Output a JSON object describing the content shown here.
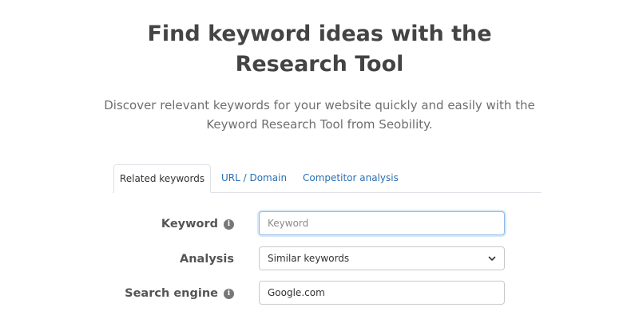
{
  "hero": {
    "title_line1": "Find keyword ideas with the",
    "title_line2": "Research Tool",
    "subtitle_line1": "Discover relevant keywords for your website quickly and easily with the",
    "subtitle_line2": "Keyword Research Tool from Seobility."
  },
  "tabs": [
    {
      "label": "Related keywords",
      "active": true
    },
    {
      "label": "URL / Domain",
      "active": false
    },
    {
      "label": "Competitor analysis",
      "active": false
    }
  ],
  "form": {
    "keyword": {
      "label": "Keyword",
      "placeholder": "Keyword",
      "value": "",
      "info_icon": "info-icon"
    },
    "analysis": {
      "label": "Analysis",
      "selected": "Similar keywords",
      "icon": "chevron-down-icon"
    },
    "search_engine": {
      "label": "Search engine",
      "value": "Google.com",
      "info_icon": "info-icon"
    }
  },
  "colors": {
    "link": "#2a6fb3",
    "heading": "#444444",
    "focus_border": "#8fbbe6"
  }
}
